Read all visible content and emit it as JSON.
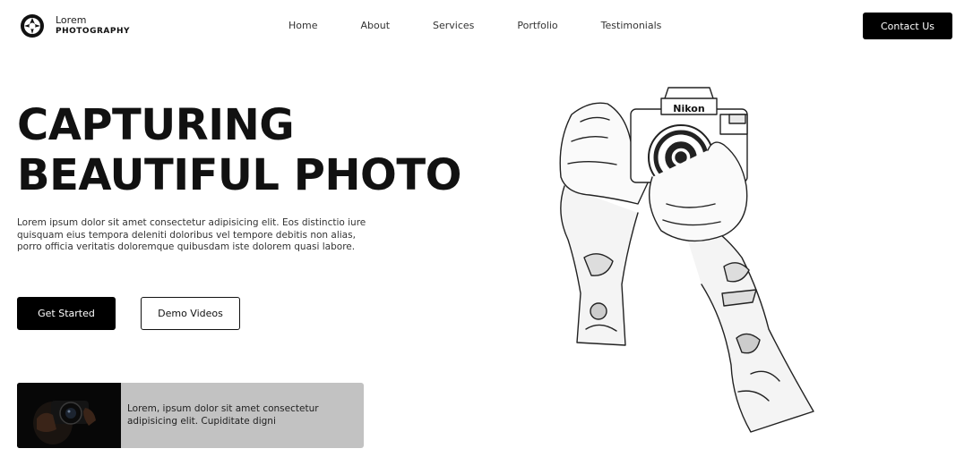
{
  "brand": {
    "line1": "Lorem",
    "line2": "PHOTOGRAPHY",
    "icon": "aperture-logo-icon"
  },
  "nav": {
    "items": [
      {
        "label": "Home"
      },
      {
        "label": "About"
      },
      {
        "label": "Services"
      },
      {
        "label": "Portfolio"
      },
      {
        "label": "Testimonials"
      }
    ],
    "contact_label": "Contact Us"
  },
  "hero": {
    "title_line1": "CAPTURING",
    "title_line2": "BEAUTIFUL PHOTO",
    "description": "Lorem ipsum dolor sit amet consectetur adipisicing elit. Eos distinctio iure quisquam eius tempora deleniti doloribus vel tempore debitis non alias, porro officia veritatis doloremque quibusdam iste dolorem quasi labore.",
    "primary_button": "Get Started",
    "secondary_button": "Demo Videos"
  },
  "card": {
    "text": "Lorem, ipsum dolor sit amet consectetur adipisicing elit. Cupiditate digni",
    "image": "camera-photographer-thumbnail"
  },
  "illustration": {
    "camera_brand": "Nikon",
    "subject": "tattooed-hands-holding-camera"
  },
  "colors": {
    "accent": "#000000",
    "background": "#ffffff",
    "card": "#c2c2c2"
  }
}
